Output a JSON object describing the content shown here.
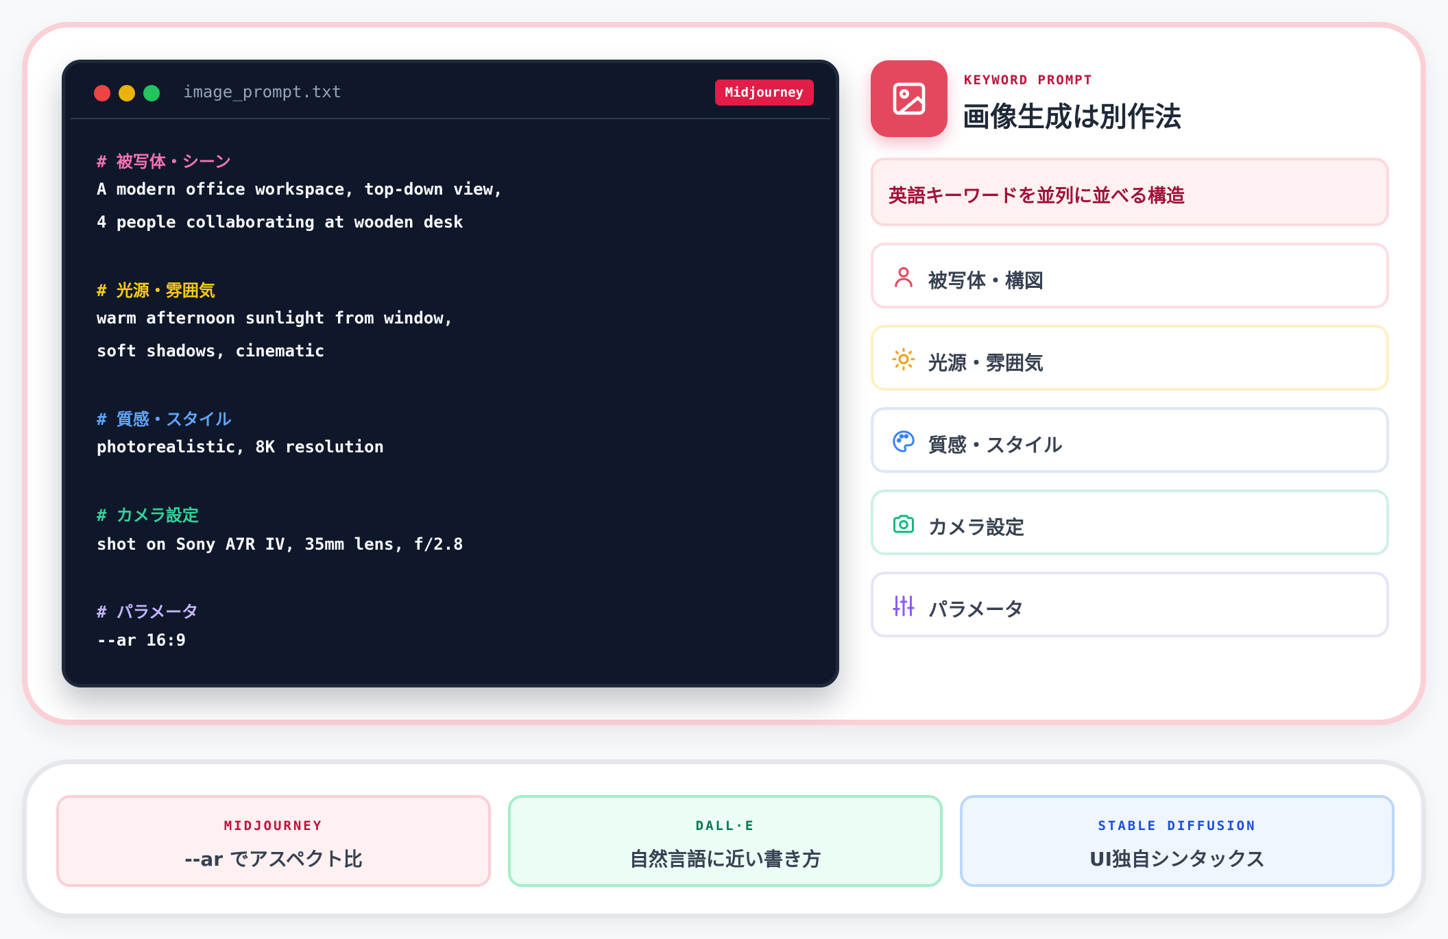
{
  "code_window": {
    "filename": "image_prompt.txt",
    "badge": "Midjourney",
    "lines": {
      "comment_1": "# 被写体・シーン",
      "line_1a": "A modern office workspace, top-down view,",
      "line_1b": "4 people collaborating at wooden desk",
      "comment_2": "# 光源・雰囲気",
      "line_2a": "warm afternoon sunlight from window,",
      "line_2b": "soft shadows, cinematic",
      "comment_3": "# 質感・スタイル",
      "line_3a": "photorealistic, 8K resolution",
      "comment_4": "# カメラ設定",
      "line_4a": "shot on Sony A7R IV, 35mm lens, f/2.8",
      "comment_5": "# パラメータ",
      "line_5a": "--ar 16:9"
    }
  },
  "panel": {
    "kicker": "KEYWORD PROMPT",
    "heading": "画像生成は別作法",
    "banner": "英語キーワードを並列に並べる構造",
    "categories": [
      {
        "label": "被写体・構図",
        "icon": "person-icon",
        "color": "#e4485e"
      },
      {
        "label": "光源・雰囲気",
        "icon": "sun-icon",
        "color": "#f59e0b"
      },
      {
        "label": "質感・スタイル",
        "icon": "palette-icon",
        "color": "#3b82f6"
      },
      {
        "label": "カメラ設定",
        "icon": "camera-icon",
        "color": "#10b981"
      },
      {
        "label": "パラメータ",
        "icon": "sliders-icon",
        "color": "#8b5cf6"
      }
    ]
  },
  "tools": [
    {
      "name": "MIDJOURNEY",
      "desc": "--ar でアスペクト比"
    },
    {
      "name": "DALL·E",
      "desc": "自然言語に近い書き方"
    },
    {
      "name": "STABLE DIFFUSION",
      "desc": "UI独自シンタックス"
    }
  ],
  "colors": {
    "accent": "#e4485e",
    "code_background": "#0f172a",
    "badge": "#e11d48"
  }
}
